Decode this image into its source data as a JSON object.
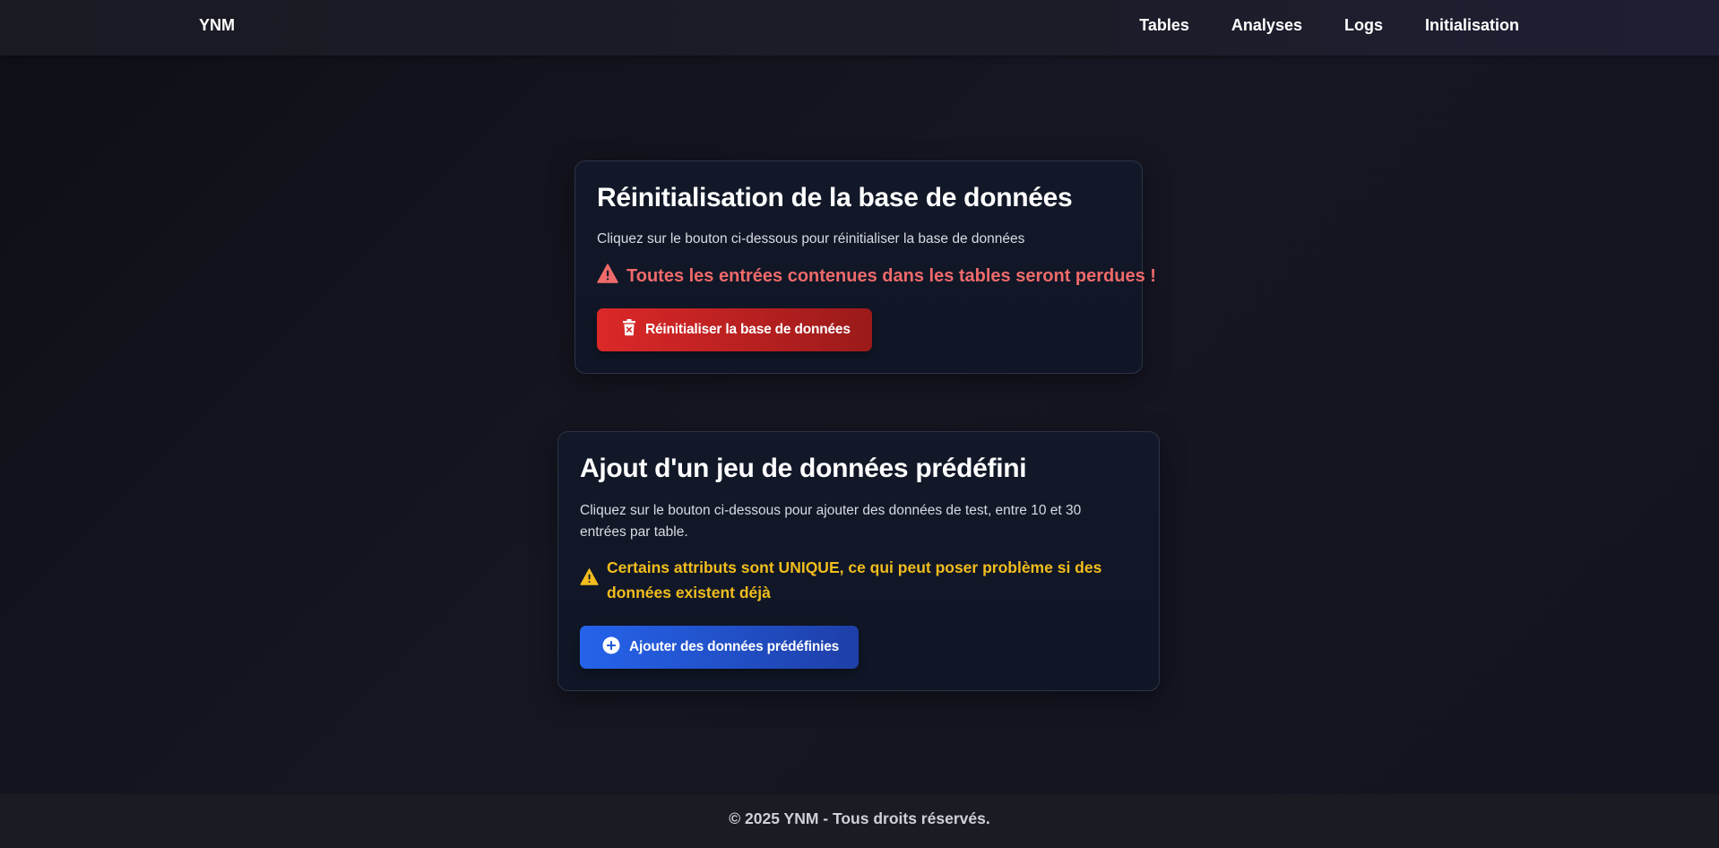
{
  "nav": {
    "brand": "YNM",
    "links": [
      "Tables",
      "Analyses",
      "Logs",
      "Initialisation"
    ]
  },
  "reset_card": {
    "title": "Réinitialisation de la base de données",
    "description": "Cliquez sur le bouton ci-dessous pour réinitialiser la base de données",
    "warning": "Toutes les entrées contenues dans les tables seront perdues !",
    "button_label": "Réinitialiser la base de données",
    "button_icon": "trash-icon",
    "warning_icon": "warning-triangle-icon"
  },
  "seed_card": {
    "title": "Ajout d'un jeu de données prédéfini",
    "description": "Cliquez sur le bouton ci-dessous pour ajouter des données de test, entre 10 et 30 entrées par table.",
    "warning": "Certains attributs sont UNIQUE, ce qui peut poser problème si des données existent déjà",
    "button_label": "Ajouter des données prédéfinies",
    "button_icon": "plus-circle-icon",
    "warning_icon": "warning-triangle-icon"
  },
  "footer": {
    "text": "© 2025 YNM - Tous droits réservés."
  },
  "colors": {
    "danger": "#dc2828",
    "danger_text": "#f06a6a",
    "warning_text": "#f2bd1d",
    "primary": "#2563eb",
    "card_bg": "#121828",
    "page_bg": "#13131c"
  }
}
